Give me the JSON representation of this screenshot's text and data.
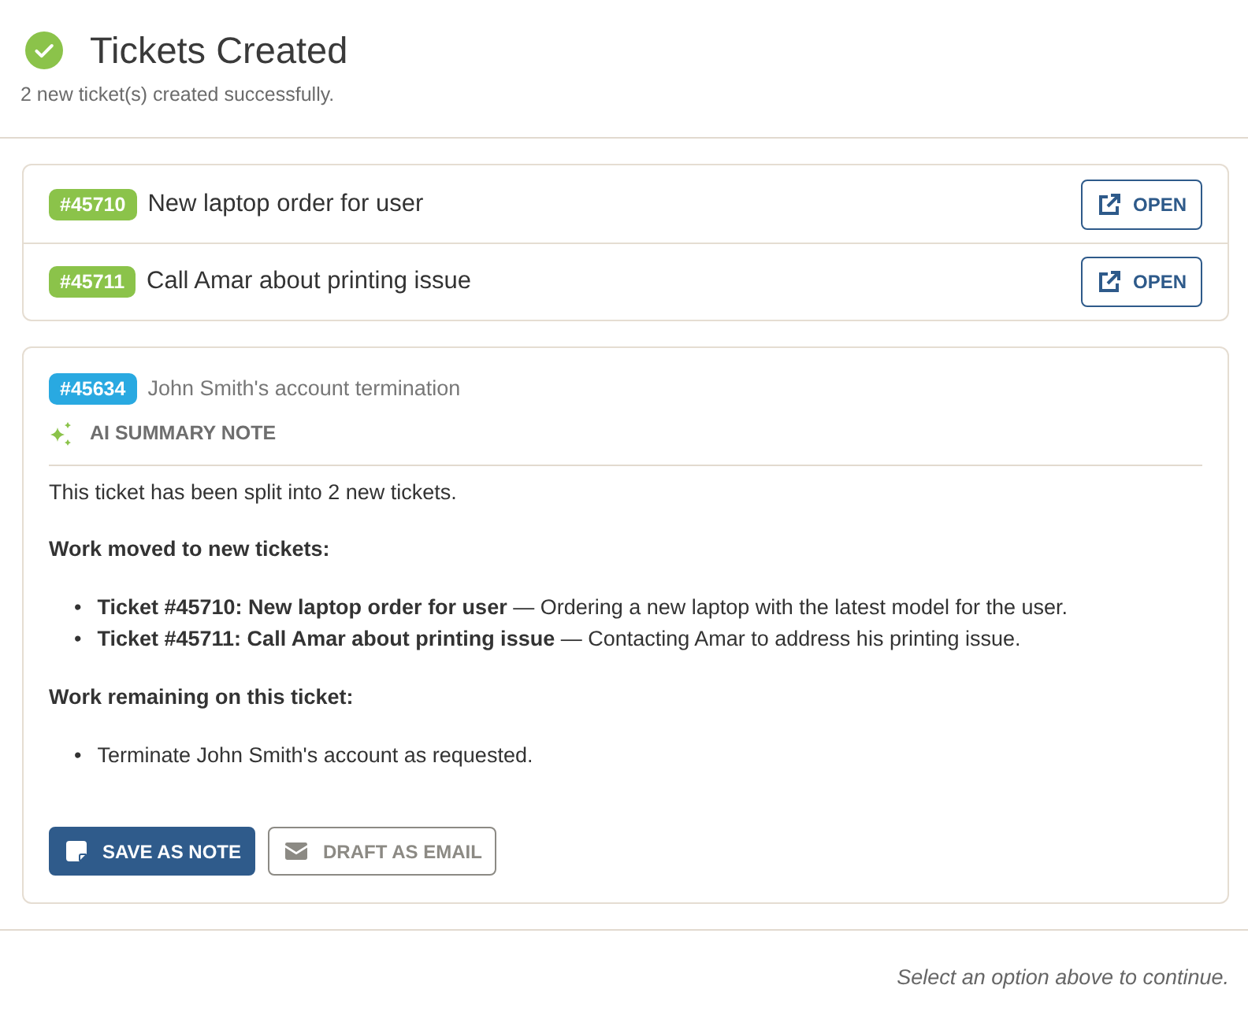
{
  "header": {
    "title": "Tickets Created",
    "subtitle": "2 new ticket(s) created successfully."
  },
  "created_tickets": [
    {
      "number": "#45710",
      "title": "New laptop order for user",
      "action": "OPEN"
    },
    {
      "number": "#45711",
      "title": "Call Amar about printing issue",
      "action": "OPEN"
    }
  ],
  "source_ticket": {
    "number": "#45634",
    "title": "John Smith's account termination",
    "section_label": "AI SUMMARY NOTE",
    "note": [
      {
        "kind": "paragraph",
        "text": "This ticket has been split into 2 new tickets."
      },
      {
        "kind": "heading",
        "text": "Work moved to new tickets:"
      },
      {
        "kind": "list",
        "items": [
          {
            "marker": "•",
            "text": "**Ticket #45710: New laptop order for user** — Ordering a new laptop with the latest model for the user."
          },
          {
            "marker": "•",
            "text": "**Ticket #45711: Call Amar about printing issue** — Contacting Amar to address his printing issue."
          }
        ]
      },
      {
        "kind": "heading",
        "text": "Work remaining on this ticket:"
      },
      {
        "kind": "list",
        "items": [
          {
            "marker": "•",
            "text": "Terminate John Smith's account as requested."
          }
        ]
      }
    ],
    "actions": [
      {
        "kind": "primary",
        "label": "SAVE AS NOTE"
      },
      {
        "kind": "secondary",
        "label": "DRAFT AS EMAIL"
      }
    ]
  },
  "footer_hint": "Select an option above to continue."
}
